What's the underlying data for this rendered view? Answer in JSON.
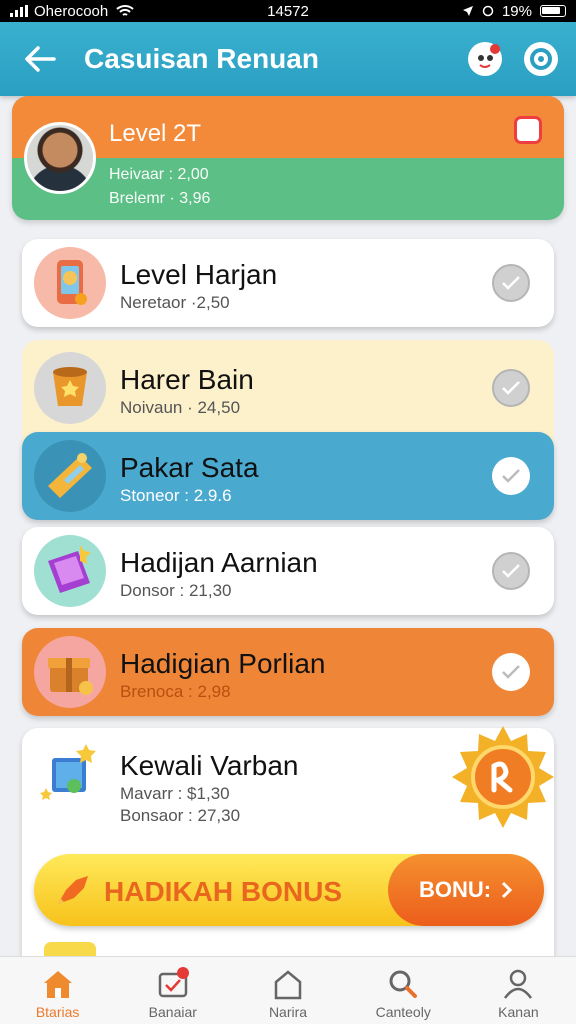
{
  "status": {
    "carrier": "Oherocooh",
    "time": "14572",
    "battery": "19%"
  },
  "appbar": {
    "title": "Casuisan Renuan"
  },
  "level": {
    "title": "Level 2T",
    "line1": "Heivaar : 2,00",
    "line2": "Brelemr · 3,96"
  },
  "rewards": [
    {
      "title": "Level Harjan",
      "subtitle": "Neretaor ·2,50",
      "checked": false
    },
    {
      "title": "Harer Bain",
      "subtitle": "Noivaun · 24,50",
      "checked": false
    },
    {
      "title": "Pakar Sata",
      "subtitle": "Stoneor : 2.9.6",
      "checked": true
    },
    {
      "title": "Hadijan Aarnian",
      "subtitle": "Donsor : 21,30",
      "checked": false
    },
    {
      "title": "Hadigian Porlian",
      "subtitle": "Brenoca : 2,98",
      "checked": true
    }
  ],
  "special": {
    "title": "Kewali Varban",
    "line1": "Mavarr : $1,30",
    "line2": "Bonsaor : 27,30"
  },
  "bonus": {
    "label": "HADIKAH BONUS",
    "button": "BONU:"
  },
  "tabs": [
    {
      "label": "Btarias",
      "icon": "home-icon"
    },
    {
      "label": "Banaiar",
      "icon": "checklist-icon"
    },
    {
      "label": "Narira",
      "icon": "house-outline-icon"
    },
    {
      "label": "Canteoly",
      "icon": "search-icon"
    },
    {
      "label": "Kanan",
      "icon": "profile-icon"
    }
  ],
  "colors": {
    "appbar": "#2a9fc2",
    "orange": "#f38a3a",
    "green": "#5cbf86",
    "yellow": "#fdf1cc",
    "blue": "#4aa9cf",
    "accent": "#ee7a2a"
  }
}
